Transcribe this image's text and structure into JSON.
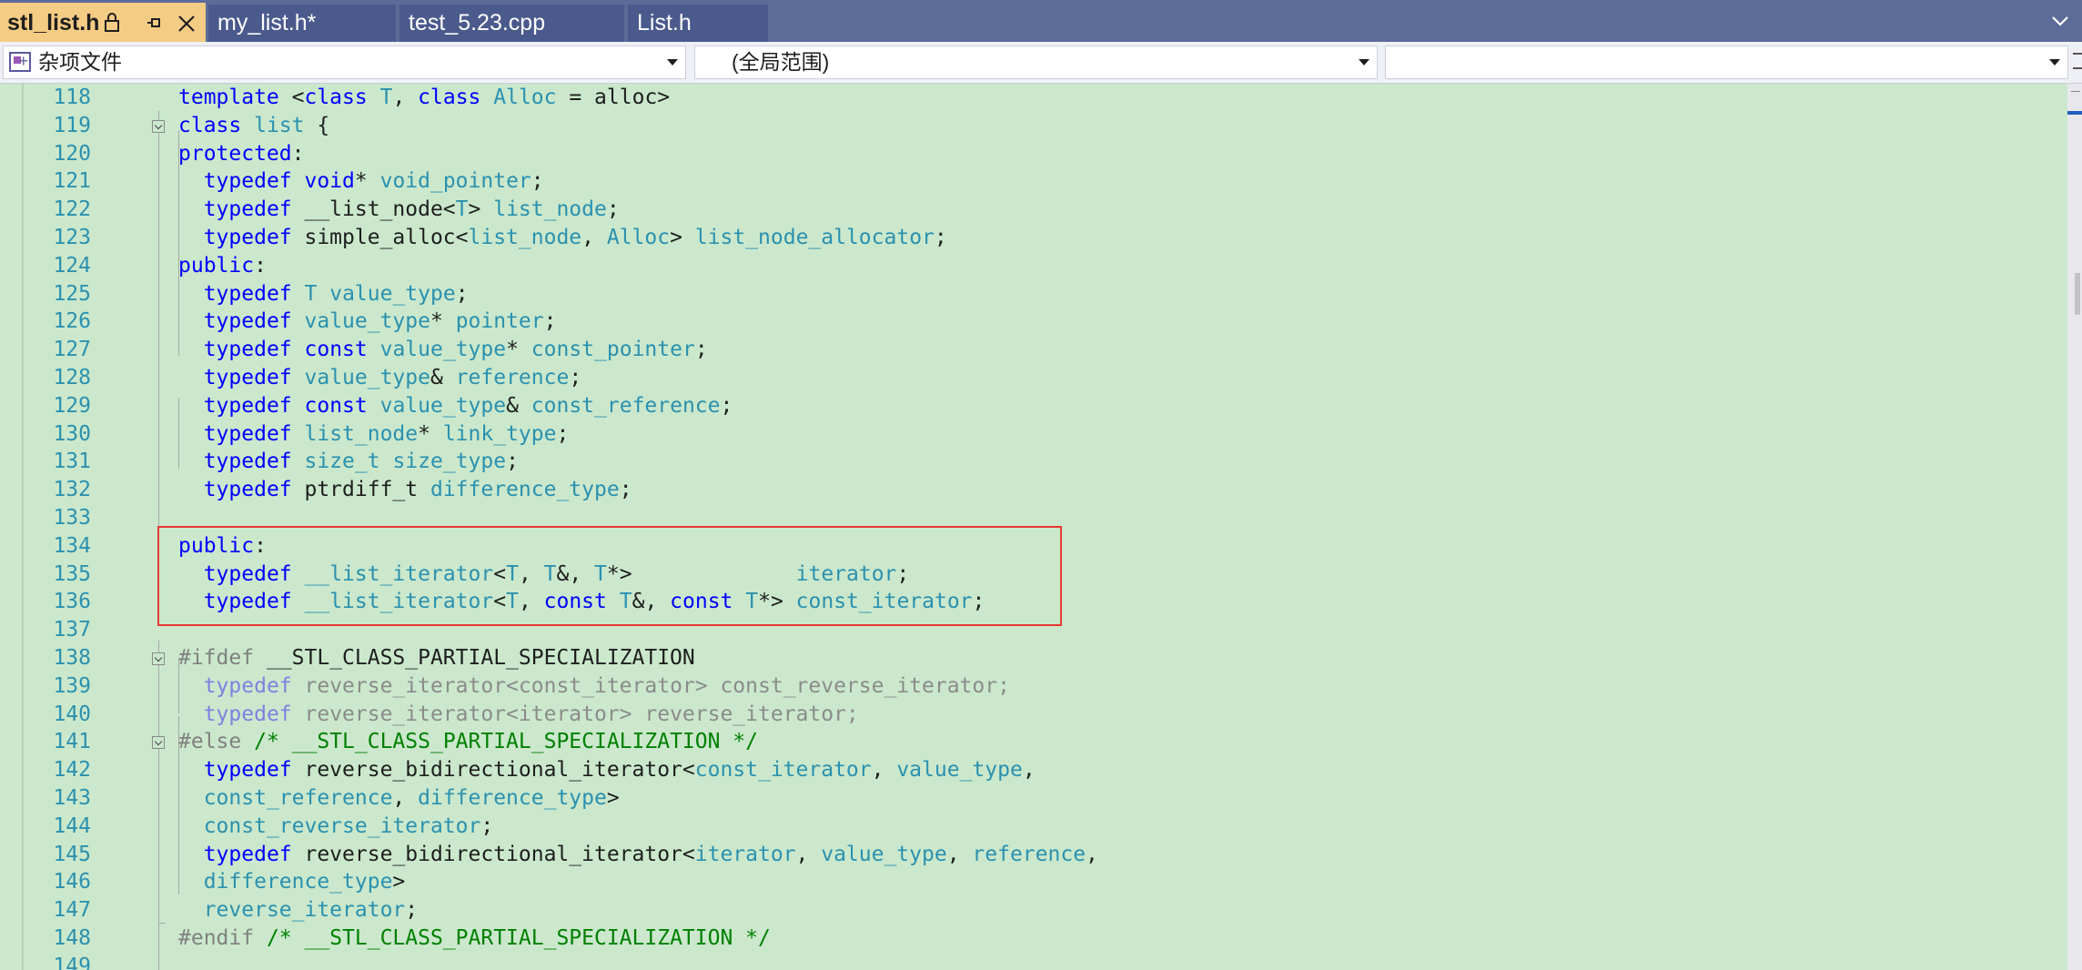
{
  "tabs": {
    "active": "stl_list.h",
    "items": [
      "my_list.h*",
      "test_5.23.cpp",
      "List.h"
    ]
  },
  "navbar": {
    "project": "杂项文件",
    "scope": "(全局范围)",
    "member": ""
  },
  "editor": {
    "line_numbers": [
      "118",
      "119",
      "120",
      "121",
      "122",
      "123",
      "124",
      "125",
      "126",
      "127",
      "128",
      "129",
      "130",
      "131",
      "132",
      "133",
      "134",
      "135",
      "136",
      "137",
      "138",
      "139",
      "140",
      "141",
      "142",
      "143",
      "144",
      "145",
      "146",
      "147",
      "148",
      "149"
    ]
  },
  "colors": {
    "background": "#cbe8cc",
    "keyword": "#0000ff",
    "type": "#2b91af",
    "comment": "#008000",
    "preprocessor": "#808080",
    "highlight_box": "#e53935",
    "active_tab": "#f5cc84",
    "tab_strip": "#5d6b99"
  },
  "icons": {
    "tab_lock": "lock-icon",
    "tab_pin": "pin-icon",
    "tab_close": "close-icon",
    "tab_overflow": "chevron-down-icon",
    "project": "misc-files-project-icon",
    "fold": "collapse-chevron-icon"
  }
}
